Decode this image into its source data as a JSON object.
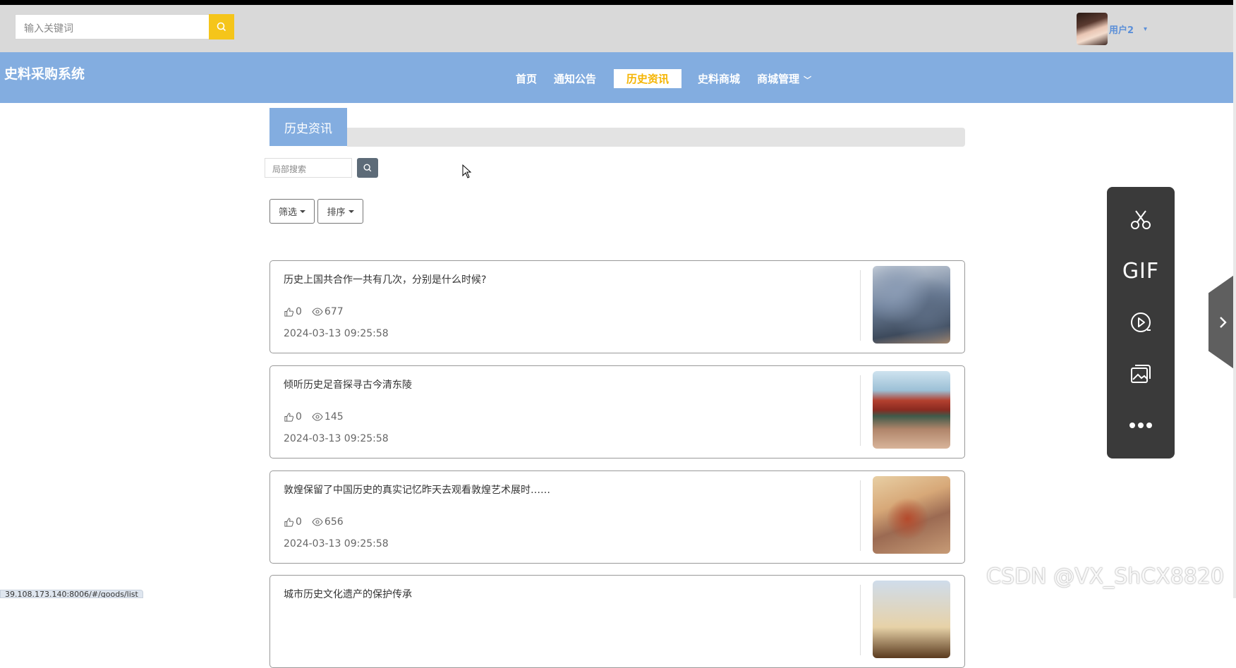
{
  "header": {
    "search_placeholder": "输入关键词",
    "username": "用户2"
  },
  "nav": {
    "brand": "史料采购系统",
    "items": [
      {
        "label": "首页"
      },
      {
        "label": "通知公告"
      },
      {
        "label": "历史资讯",
        "active": true
      },
      {
        "label": "史料商城"
      },
      {
        "label": "商城管理"
      }
    ]
  },
  "section": {
    "title": "历史资讯",
    "local_search_placeholder": "局部搜索",
    "filter_label": "筛选",
    "sort_label": "排序"
  },
  "articles": [
    {
      "title": "历史上国共合作一共有几次，分别是什么时候?",
      "likes": "0",
      "views": "677",
      "date": "2024-03-13 09:25:58"
    },
    {
      "title": "倾听历史足音探寻古今清东陵",
      "likes": "0",
      "views": "145",
      "date": "2024-03-13 09:25:58"
    },
    {
      "title": "敦煌保留了中国历史的真实记忆昨天去观看敦煌艺术展时……",
      "likes": "0",
      "views": "656",
      "date": "2024-03-13 09:25:58"
    },
    {
      "title": "城市历史文化遗产的保护传承"
    }
  ],
  "side_panel": {
    "gif_label": "GIF"
  },
  "status_url": "39.108.173.140:8006/#/goods/list",
  "watermark": "CSDN @VX_ShCX8820",
  "colors": {
    "navbar": "#83ade0",
    "accent": "#f5c51a",
    "active_nav_text": "#f5b400"
  }
}
